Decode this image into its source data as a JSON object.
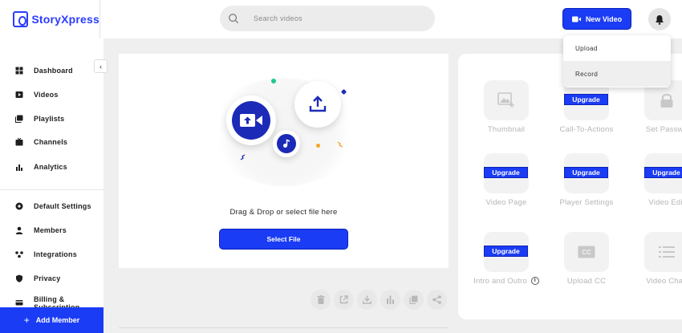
{
  "app": {
    "name": "StoryXpress"
  },
  "search": {
    "placeholder": "Search videos"
  },
  "header": {
    "new_video_label": "New Video"
  },
  "new_video_menu": {
    "items": [
      "Upload",
      "Record"
    ]
  },
  "sidebar": {
    "items": [
      {
        "label": "Dashboard",
        "icon": "grid-icon"
      },
      {
        "label": "Videos",
        "icon": "video-icon"
      },
      {
        "label": "Playlists",
        "icon": "playlist-icon"
      },
      {
        "label": "Channels",
        "icon": "channel-icon"
      },
      {
        "label": "Analytics",
        "icon": "bar-chart-icon"
      },
      {
        "label": "Default Settings",
        "icon": "settings-icon"
      },
      {
        "label": "Members",
        "icon": "members-icon"
      },
      {
        "label": "Integrations",
        "icon": "integrations-icon"
      },
      {
        "label": "Privacy",
        "icon": "shield-icon"
      },
      {
        "label": "Billing & Subscription",
        "icon": "billing-icon"
      }
    ],
    "add_member_label": "Add Member"
  },
  "upload": {
    "drag_text": "Drag & Drop or select file here",
    "select_file_label": "Select File"
  },
  "features": {
    "upgrade_label": "Upgrade",
    "items": [
      {
        "label": "Thumbnail",
        "upgrade": false
      },
      {
        "label": "Call-To-Actions",
        "upgrade": true
      },
      {
        "label": "Set Passwo",
        "upgrade": false
      },
      {
        "label": "Video Page",
        "upgrade": true
      },
      {
        "label": "Player Settings",
        "upgrade": true
      },
      {
        "label": "Video Edit",
        "upgrade": true
      },
      {
        "label": "Intro and Outro",
        "upgrade": true
      },
      {
        "label": "Upload CC",
        "upgrade": false
      },
      {
        "label": "Video Chap",
        "upgrade": false
      }
    ]
  },
  "toolbar": {
    "icons": [
      "delete-icon",
      "share-out-icon",
      "download-icon",
      "analytics-icon",
      "copy-icon",
      "share-icon"
    ]
  },
  "colors": {
    "accent": "#1a3cf5",
    "accent_dark": "#1c2ab8"
  }
}
